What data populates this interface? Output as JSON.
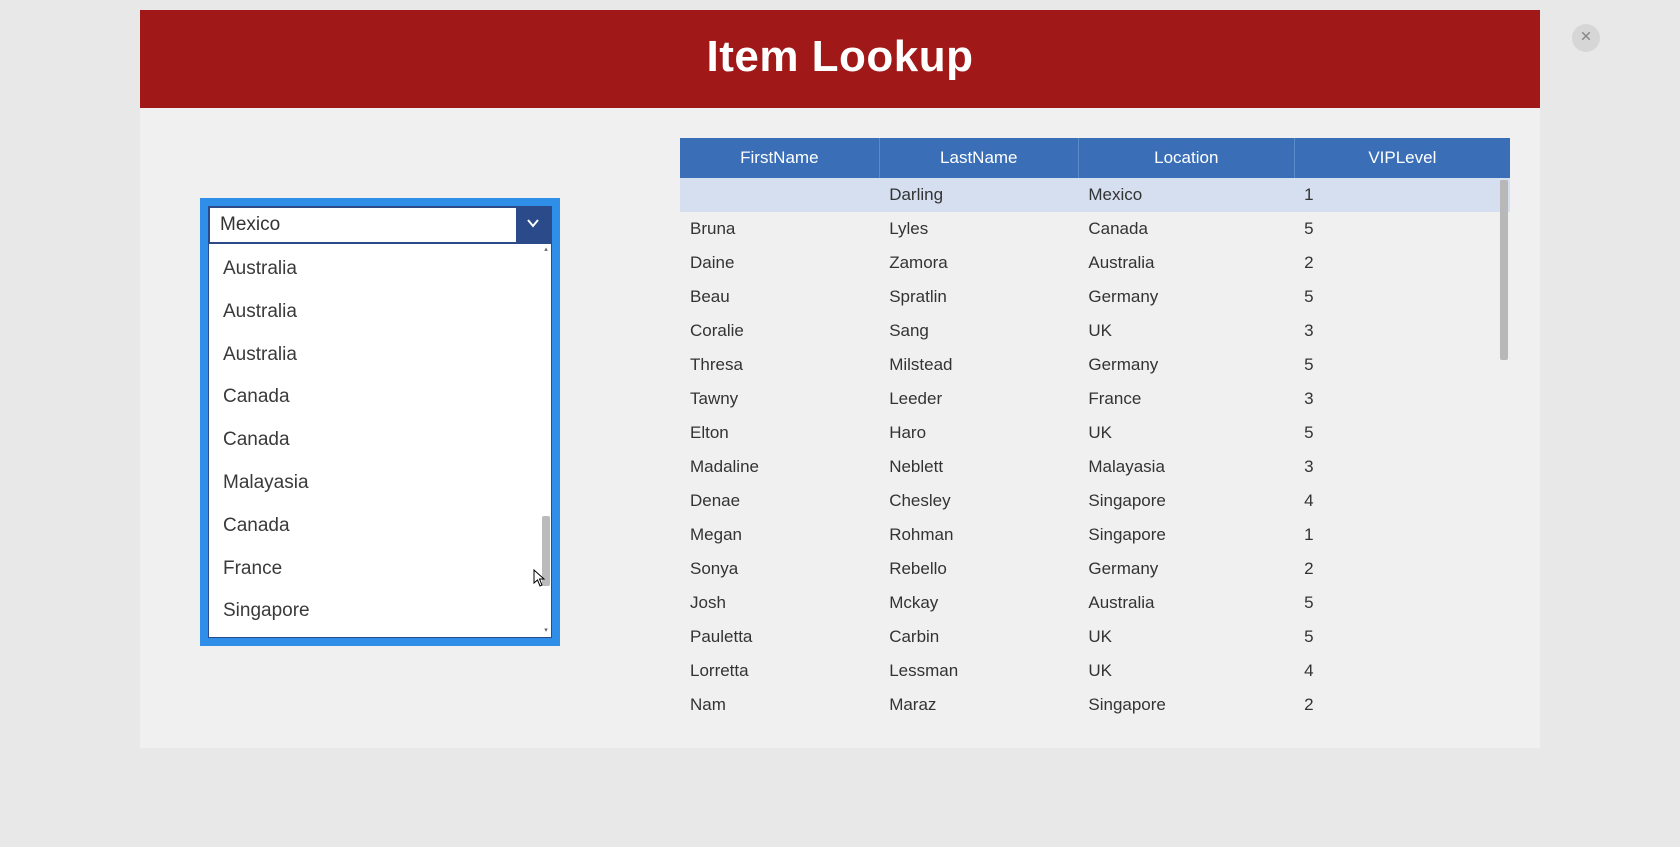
{
  "header": {
    "title": "Item Lookup"
  },
  "dropdown": {
    "selected": "Mexico",
    "options": [
      "Australia",
      "Australia",
      "Australia",
      "Canada",
      "Canada",
      "Malayasia",
      "Canada",
      "France",
      "Singapore"
    ]
  },
  "table": {
    "columns": [
      "FirstName",
      "LastName",
      "Location",
      "VIPLevel"
    ],
    "rows": [
      {
        "first": "",
        "last": "Darling",
        "loc": "Mexico",
        "vip": "1",
        "selected": true
      },
      {
        "first": "Bruna",
        "last": "Lyles",
        "loc": "Canada",
        "vip": "5"
      },
      {
        "first": "Daine",
        "last": "Zamora",
        "loc": "Australia",
        "vip": "2"
      },
      {
        "first": "Beau",
        "last": "Spratlin",
        "loc": "Germany",
        "vip": "5"
      },
      {
        "first": "Coralie",
        "last": "Sang",
        "loc": "UK",
        "vip": "3"
      },
      {
        "first": "Thresa",
        "last": "Milstead",
        "loc": "Germany",
        "vip": "5"
      },
      {
        "first": "Tawny",
        "last": "Leeder",
        "loc": "France",
        "vip": "3"
      },
      {
        "first": "Elton",
        "last": "Haro",
        "loc": "UK",
        "vip": "5"
      },
      {
        "first": "Madaline",
        "last": "Neblett",
        "loc": "Malayasia",
        "vip": "3"
      },
      {
        "first": "Denae",
        "last": "Chesley",
        "loc": "Singapore",
        "vip": "4"
      },
      {
        "first": "Megan",
        "last": "Rohman",
        "loc": "Singapore",
        "vip": "1"
      },
      {
        "first": "Sonya",
        "last": "Rebello",
        "loc": "Germany",
        "vip": "2"
      },
      {
        "first": "Josh",
        "last": "Mckay",
        "loc": "Australia",
        "vip": "5"
      },
      {
        "first": "Pauletta",
        "last": "Carbin",
        "loc": "UK",
        "vip": "5"
      },
      {
        "first": "Lorretta",
        "last": "Lessman",
        "loc": "UK",
        "vip": "4"
      },
      {
        "first": "Nam",
        "last": "Maraz",
        "loc": "Singapore",
        "vip": "2"
      }
    ]
  }
}
